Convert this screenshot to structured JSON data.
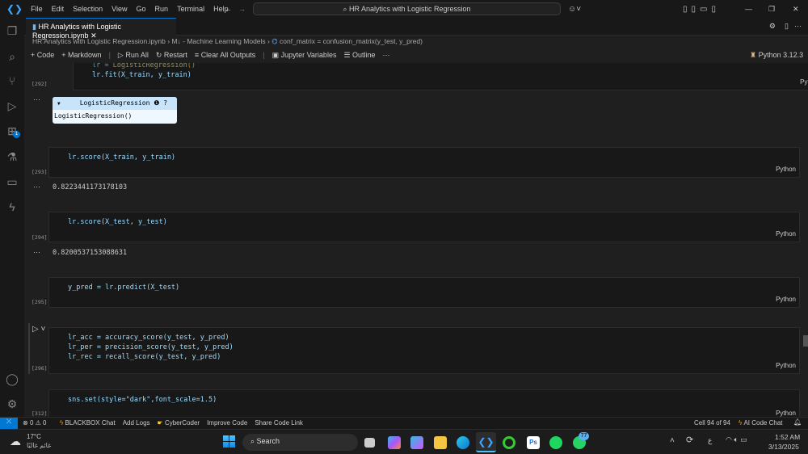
{
  "titlebar": {
    "menu": [
      "File",
      "Edit",
      "Selection",
      "View",
      "Go",
      "Run",
      "Terminal",
      "Help"
    ],
    "search": "HR Analytics with Logistic Regression"
  },
  "tab": {
    "label": "HR Analytics with Logistic Regression.ipynb"
  },
  "breadcrumb": {
    "file": "HR Analytics with Logistic Regression.ipynb",
    "section": "M↓ - Machine Learning Models",
    "symbol": "conf_matrix = confusion_matrix(y_test, y_pred)"
  },
  "toolbar": {
    "code": "+ Code",
    "markdown": "+ Markdown",
    "run_all": "▷ Run All",
    "restart": "↻ Restart",
    "clear": "Clear All Outputs",
    "variables": "Jupyter Variables",
    "outline": "☰ Outline",
    "more": "···",
    "kernel": "Python 3.12.3"
  },
  "activity": {
    "badge": "1"
  },
  "cells": [
    {
      "count": "[292]",
      "lang": "Python",
      "line1": "lr.fit(X_train, y_train)",
      "output_widget_title": "LogisticRegression",
      "output_widget_body": "LogisticRegression()"
    },
    {
      "count": "[293]",
      "lang": "Python",
      "code": "lr.score(X_train, y_train)",
      "output": "0.8223441173178103"
    },
    {
      "count": "[294]",
      "lang": "Python",
      "code": "lr.score(X_test, y_test)",
      "output": "0.8200537153088631"
    },
    {
      "count": "[295]",
      "lang": "Python",
      "code": "y_pred = lr.predict(X_test)"
    },
    {
      "count": "[296]",
      "lang": "Python",
      "lines": [
        "lr_acc = accuracy_score(y_test, y_pred)",
        "lr_per = precision_score(y_test, y_pred)",
        "lr_rec = recall_score(y_test, y_pred)"
      ]
    },
    {
      "count": "[312]",
      "lang": "Python",
      "code": "sns.set(style=\"dark\",font_scale=1.5)"
    }
  ],
  "statusbar": {
    "errors": "0",
    "warnings": "0",
    "items": [
      "BLACKBOX Chat",
      "Add Logs",
      "CyberCoder",
      "Improve Code",
      "Share Code Link"
    ],
    "cell": "Cell 94 of 94",
    "ai": "AI Code Chat"
  },
  "taskbar": {
    "weather": "17°C",
    "weather_sub": "غائم غالبًا",
    "search": "Search",
    "whatsapp_badge": "77",
    "time": "1:52 AM",
    "date": "3/13/2025",
    "lang": "ع"
  },
  "colors": {
    "accent": "#0078d4",
    "bg": "#1f1f1f",
    "editor": "#181818"
  }
}
